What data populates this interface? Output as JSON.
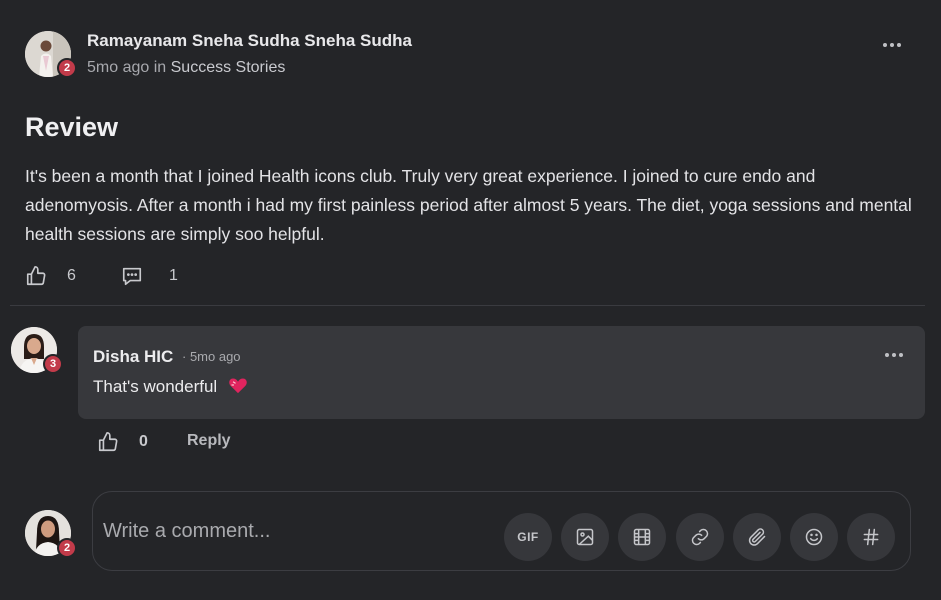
{
  "post": {
    "author": {
      "name": "Ramayanam Sneha Sudha Sneha Sudha",
      "level": "2"
    },
    "time_ago": "5mo ago",
    "in_label": "in",
    "space": "Success Stories",
    "title": "Review",
    "body": "It's been a month that I joined Health icons club. Truly very great experience. I joined to cure endo and adenomyosis. After a month i had my first painless period after almost 5 years. The diet, yoga sessions and mental health sessions are simply soo helpful.",
    "like_count": "6",
    "comment_count": "1"
  },
  "comment": {
    "author": {
      "name": "Disha HIC",
      "level": "3"
    },
    "time_ago": "· 5mo ago",
    "text": "That's wonderful",
    "like_count": "0",
    "reply_label": "Reply"
  },
  "composer": {
    "user_level": "2",
    "placeholder": "Write a comment...",
    "gif_label": "GIF",
    "tools": [
      "gif-icon",
      "image-icon",
      "video-icon",
      "link-icon",
      "attachment-icon",
      "emoji-icon",
      "hashtag-icon"
    ]
  },
  "colors": {
    "background": "#242528",
    "comment_bubble": "#37383c",
    "level_badge": "#c23b4a",
    "heart_emoji": "#e0245e"
  }
}
